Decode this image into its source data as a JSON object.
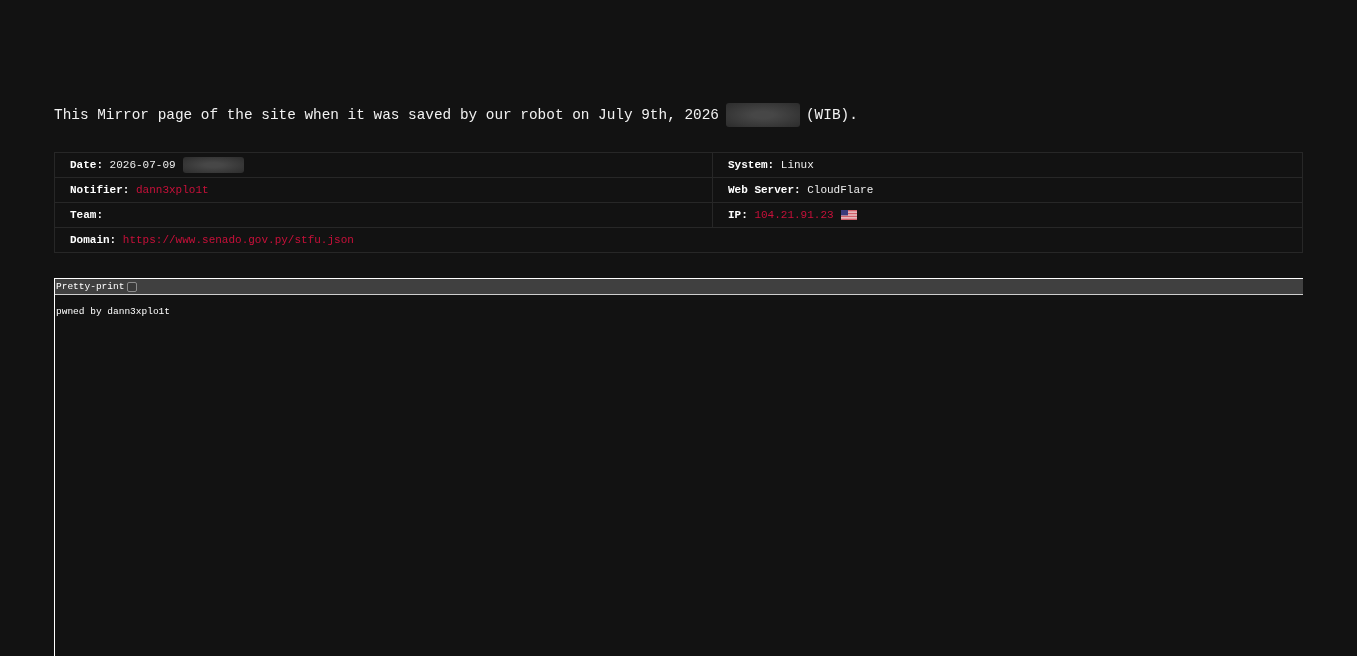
{
  "intro": {
    "text": "This Mirror page of the site when it was saved by our robot on July 9th, 2026",
    "redacted": true,
    "suffix": "(WIB)."
  },
  "details": {
    "rows": [
      {
        "cells": [
          {
            "label": "Date:",
            "value": "2026-07-09",
            "kind": "text",
            "redacted": true
          },
          {
            "label": "System:",
            "value": "Linux",
            "kind": "text",
            "redacted": false
          }
        ]
      },
      {
        "cells": [
          {
            "label": "Notifier:",
            "value": "dann3xplo1t",
            "kind": "link",
            "redacted": false
          },
          {
            "label": "Web Server:",
            "value": "CloudFlare",
            "kind": "text",
            "redacted": false
          }
        ]
      },
      {
        "cells": [
          {
            "label": "Team:",
            "kind": "text",
            "redacted": false
          },
          {
            "label": "IP:",
            "value": "104.21.91.23",
            "kind": "ip",
            "redacted": false
          }
        ]
      },
      {
        "cells": [
          {
            "label": "Domain:",
            "value": "https://www.senado.gov.py/stfu.json",
            "kind": "link",
            "redacted": false,
            "colspan": 2
          }
        ]
      }
    ]
  },
  "viewer": {
    "toolbar_label": "Pretty-print",
    "checked": false,
    "content": "pwned by dann3xplo1t"
  }
}
